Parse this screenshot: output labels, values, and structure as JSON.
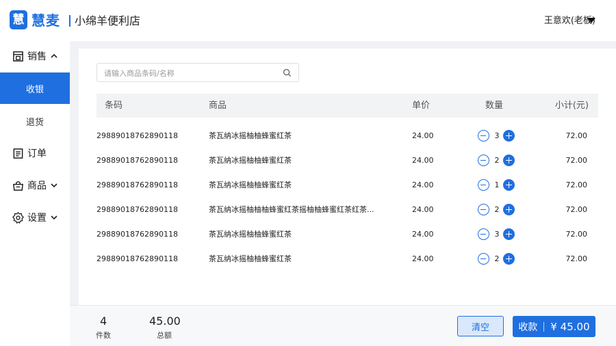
{
  "header": {
    "logo_glyph": "慧",
    "brand": "慧麦",
    "store_name": "小绵羊便利店",
    "user": "王意欢(老板)"
  },
  "sidebar": {
    "sales": {
      "label": "销售",
      "icon": "store-icon",
      "expanded": true
    },
    "sales_items": [
      {
        "label": "收银",
        "active": true
      },
      {
        "label": "退货",
        "active": false
      }
    ],
    "orders": {
      "label": "订单",
      "icon": "document-icon"
    },
    "products": {
      "label": "商品",
      "icon": "bag-icon"
    },
    "settings": {
      "label": "设置",
      "icon": "gear-icon"
    }
  },
  "search": {
    "placeholder": "请输入商品条码/名称"
  },
  "table": {
    "columns": [
      "条码",
      "商品",
      "单价",
      "数量",
      "小计(元)"
    ],
    "rows": [
      {
        "barcode": "29889018762890118",
        "name": "茶瓦纳冰摇柚柚蜂蜜红茶",
        "price": "24.00",
        "qty": "3",
        "subtotal": "72.00"
      },
      {
        "barcode": "29889018762890118",
        "name": "茶瓦纳冰摇柚柚蜂蜜红茶",
        "price": "24.00",
        "qty": "2",
        "subtotal": "72.00"
      },
      {
        "barcode": "29889018762890118",
        "name": "茶瓦纳冰摇柚柚蜂蜜红茶",
        "price": "24.00",
        "qty": "1",
        "subtotal": "72.00"
      },
      {
        "barcode": "29889018762890118",
        "name": "茶瓦纳冰摇柚柚柚蜂蜜红茶摇柚柚蜂蜜红茶红茶...",
        "price": "24.00",
        "qty": "2",
        "subtotal": "72.00"
      },
      {
        "barcode": "29889018762890118",
        "name": "茶瓦纳冰摇柚柚蜂蜜红茶",
        "price": "24.00",
        "qty": "3",
        "subtotal": "72.00"
      },
      {
        "barcode": "29889018762890118",
        "name": "茶瓦纳冰摇柚柚蜂蜜红茶",
        "price": "24.00",
        "qty": "2",
        "subtotal": "72.00"
      }
    ]
  },
  "footer": {
    "count_value": "4",
    "count_label": "件数",
    "total_value": "45.00",
    "total_label": "总额",
    "clear_label": "清空",
    "pay_label": "收款",
    "pay_amount": "¥ 45.00"
  },
  "colors": {
    "primary": "#1f6fe0",
    "clear_bg": "#d9e8fb",
    "page_bg": "#f0f2f5"
  }
}
